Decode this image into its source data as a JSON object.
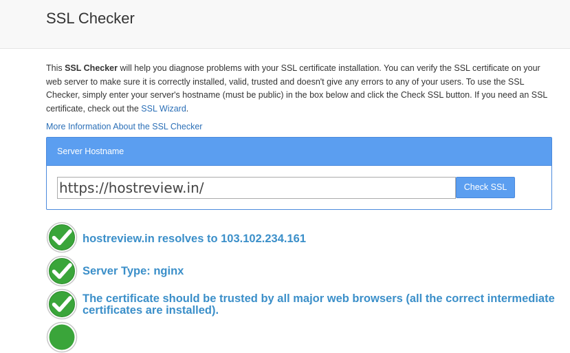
{
  "header": {
    "title": "SSL Checker"
  },
  "intro": {
    "part1": "This ",
    "bold": "SSL Checker",
    "part2": " will help you diagnose problems with your SSL certificate installation. You can verify the SSL certificate on your web server to make sure it is correctly installed, valid, trusted and doesn't give any errors to any of your users. To use the SSL Checker, simply enter your server's hostname (must be public) in the box below and click the Check SSL button. If you need an SSL certificate, check out the ",
    "wizard_link": "SSL Wizard",
    "part3": "."
  },
  "more_info_link": "More Information About the SSL Checker",
  "panel": {
    "heading": "Server Hostname",
    "input_value": "https://hostreview.in/",
    "button_label": "Check SSL"
  },
  "results": [
    {
      "text": "hostreview.in resolves to 103.102.234.161",
      "status": "pass"
    },
    {
      "text": "Server Type: nginx",
      "status": "pass"
    },
    {
      "text": "The certificate should be trusted by all major web browsers (all the correct intermediate certificates are installed).",
      "status": "pass"
    }
  ],
  "colors": {
    "accent": "#5b9ef0",
    "link": "#2b6fb7",
    "result_text": "#3b8fc9",
    "check_green": "#3aa53a"
  },
  "icons": {
    "result_icon": "green-checkmark-icon"
  }
}
